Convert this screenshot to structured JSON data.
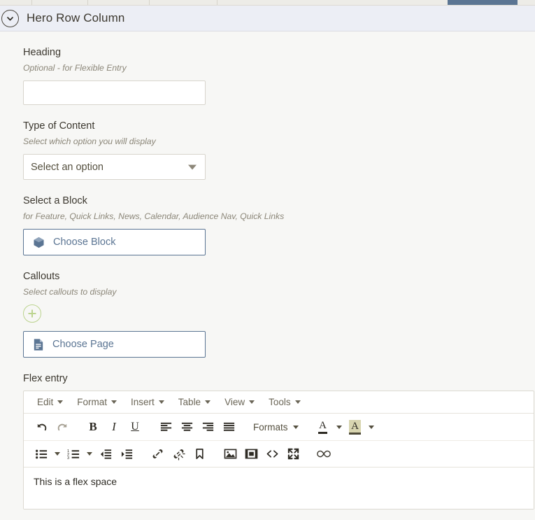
{
  "top_strip": {
    "accent_color": "#5b7593",
    "active_tab_indicator": "active-tab"
  },
  "panel": {
    "title": "Hero Row Column",
    "collapse_icon": "chevron-down-icon"
  },
  "fields": {
    "heading": {
      "label": "Heading",
      "hint": "Optional - for Flexible Entry",
      "value": "",
      "placeholder": ""
    },
    "type_of_content": {
      "label": "Type of Content",
      "hint": "Select which option you will display",
      "value": "Select an option"
    },
    "select_a_block": {
      "label": "Select a Block",
      "hint": "for Feature, Quick Links, News, Calendar, Audience Nav, Quick Links",
      "button_label": "Choose Block",
      "button_icon": "cube-block-icon",
      "accent_color": "#5b7593"
    },
    "callouts": {
      "label": "Callouts",
      "hint": "Select callouts to display",
      "add_icon": "plus-circle-icon",
      "add_color": "#bcd48f",
      "button_label": "Choose Page",
      "button_icon": "page-document-icon"
    },
    "flex_entry": {
      "label": "Flex entry"
    }
  },
  "editor": {
    "menubar": [
      {
        "label": "Edit"
      },
      {
        "label": "Format"
      },
      {
        "label": "Insert"
      },
      {
        "label": "Table"
      },
      {
        "label": "View"
      },
      {
        "label": "Tools"
      }
    ],
    "toolbar_row1": {
      "undo": "undo-icon",
      "redo": "redo-icon",
      "bold": "B",
      "italic": "I",
      "underline": "U",
      "align_left": "align-left-icon",
      "align_center": "align-center-icon",
      "align_right": "align-right-icon",
      "align_justify": "align-justify-icon",
      "formats_label": "Formats",
      "text_color": "text-color-icon",
      "background_color": "background-color-icon",
      "background_swatch": "#d8d5b0"
    },
    "toolbar_row2": {
      "bullet_list": "bullet-list-icon",
      "numbered_list": "numbered-list-icon",
      "outdent": "outdent-icon",
      "indent": "indent-icon",
      "link": "link-icon",
      "unlink": "unlink-icon",
      "anchor": "anchor-bookmark-icon",
      "image": "image-icon",
      "media": "media-video-icon",
      "source_code": "source-code-icon",
      "fullscreen": "fullscreen-icon",
      "nonbreaking": "infinity-icon"
    },
    "content": "This is a flex space"
  }
}
